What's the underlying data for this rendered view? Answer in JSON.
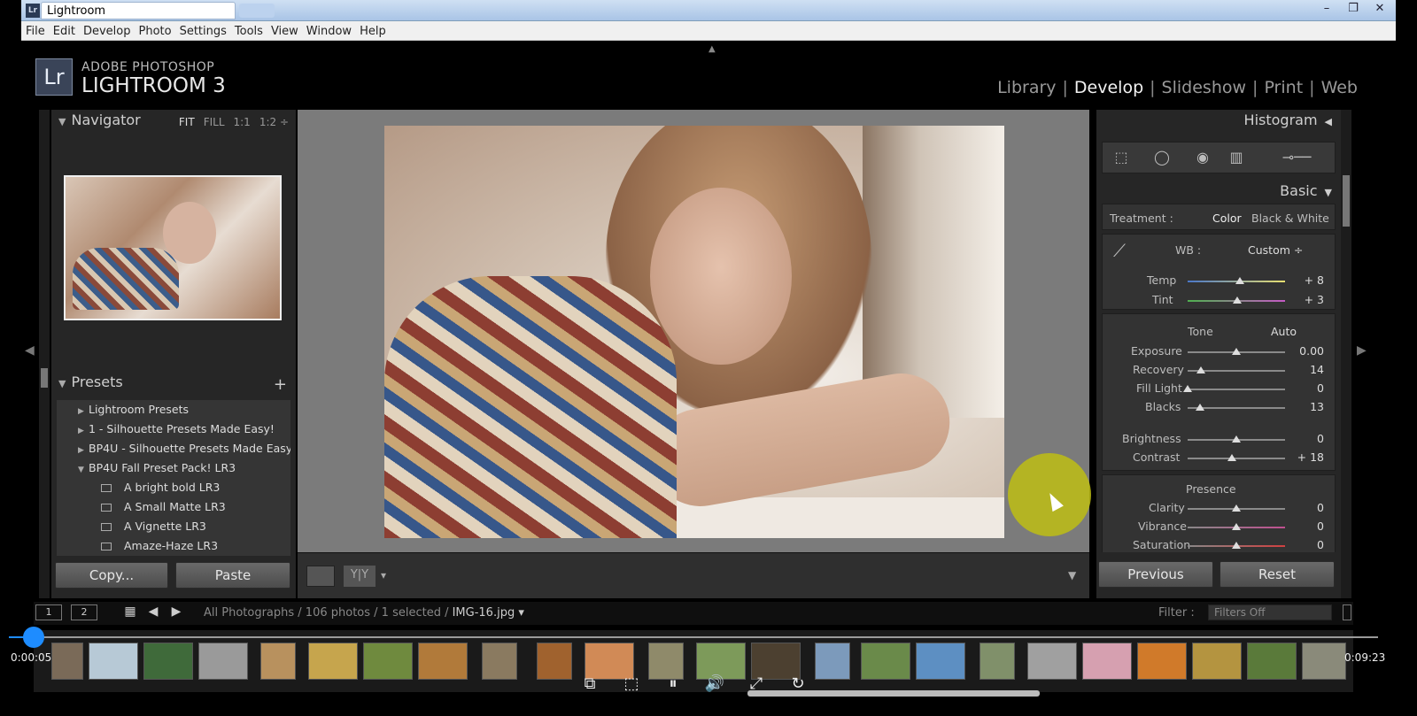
{
  "window": {
    "title": "Lightroom",
    "app_icon": "Lr",
    "controls": [
      "–",
      "❐",
      "✕"
    ]
  },
  "menu": [
    "File",
    "Edit",
    "Develop",
    "Photo",
    "Settings",
    "Tools",
    "View",
    "Window",
    "Help"
  ],
  "header": {
    "logo_text": "Lr",
    "brand_line1": "ADOBE PHOTOSHOP",
    "brand_line2": "LIGHTROOM 3",
    "modules": [
      "Library",
      "Develop",
      "Slideshow",
      "Print",
      "Web"
    ],
    "active_module": "Develop",
    "separator": "|"
  },
  "navigator": {
    "title": "Navigator",
    "options": [
      "FIT",
      "FILL",
      "1:1",
      "1:2 ÷"
    ]
  },
  "presets": {
    "title": "Presets",
    "add_label": "+",
    "folders": [
      {
        "label": "Lightroom Presets",
        "open": false
      },
      {
        "label": "1 - Silhouette Presets Made Easy!",
        "open": false
      },
      {
        "label": "BP4U - Silhouette Presets Made Easy!",
        "open": false
      },
      {
        "label": "BP4U Fall Preset Pack! LR3",
        "open": true
      }
    ],
    "items": [
      "A bright bold LR3",
      "A Small Matte LR3",
      "A Vignette LR3",
      "Amaze-Haze LR3"
    ]
  },
  "left_buttons": {
    "copy": "Copy...",
    "paste": "Paste"
  },
  "toolbar": {
    "yy_label": "Y|Y",
    "dropdown": "▾",
    "menu_arrow": "▼"
  },
  "right_panel": {
    "histogram_title": "Histogram",
    "basic_title": "Basic",
    "treatment": {
      "label": "Treatment :",
      "options": [
        "Color",
        "Black & White"
      ],
      "selected": "Color"
    },
    "wb": {
      "label": "WB :",
      "value": "Custom ÷"
    },
    "wb_sliders": [
      {
        "name": "Temp",
        "value": "+ 8",
        "pos": 0.54
      },
      {
        "name": "Tint",
        "value": "+ 3",
        "pos": 0.51
      }
    ],
    "tone": {
      "label": "Tone",
      "auto": "Auto"
    },
    "tone_sliders": [
      {
        "name": "Exposure",
        "value": "0.00",
        "pos": 0.5
      },
      {
        "name": "Recovery",
        "value": "14",
        "pos": 0.14
      },
      {
        "name": "Fill Light",
        "value": "0",
        "pos": 0.0
      },
      {
        "name": "Blacks",
        "value": "13",
        "pos": 0.13
      }
    ],
    "tone_sliders2": [
      {
        "name": "Brightness",
        "value": "0",
        "pos": 0.5
      },
      {
        "name": "Contrast",
        "value": "+ 18",
        "pos": 0.45
      }
    ],
    "presence": {
      "label": "Presence"
    },
    "presence_sliders": [
      {
        "name": "Clarity",
        "value": "0",
        "pos": 0.5
      },
      {
        "name": "Vibrance",
        "value": "0",
        "pos": 0.5
      },
      {
        "name": "Saturation",
        "value": "0",
        "pos": 0.5
      }
    ],
    "buttons": {
      "previous": "Previous",
      "reset": "Reset"
    }
  },
  "filmstrip_bar": {
    "page1": "1",
    "page2": "2",
    "path_prefix": "All Photographs / 106 photos / 1 selected /",
    "filename": "IMG-16.jpg ▾",
    "filter_label": "Filter :",
    "filter_value": "Filters Off"
  },
  "player": {
    "elapsed": "0:00:05",
    "total": "0:09:23",
    "progress": 0.009
  },
  "colors": {
    "accent": "#1e8cff",
    "cursor_highlight": "#bebe14",
    "panel": "#262626"
  }
}
